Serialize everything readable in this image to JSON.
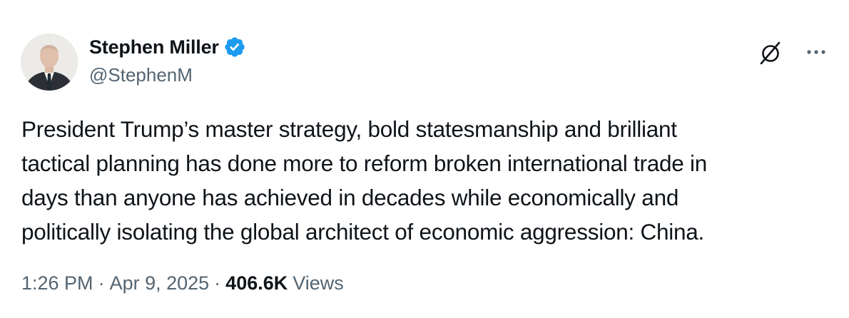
{
  "author": {
    "display_name": "Stephen Miller",
    "handle": "@StephenM",
    "verified": true
  },
  "tweet": {
    "text_lines": [
      "President Trump’s master strategy, bold statesmanship and brilliant",
      "tactical planning has done more to reform broken international trade in",
      "days than anyone has achieved in decades while economically and",
      "politically isolating the global architect of economic aggression: China."
    ]
  },
  "meta": {
    "time": "1:26 PM",
    "separator": "·",
    "date": "Apr 9, 2025",
    "views_count": "406.6K",
    "views_label": "Views"
  },
  "icons": {
    "verified": "verified-badge-icon",
    "grok": "grok-icon",
    "more": "more-options-icon"
  },
  "colors": {
    "text_primary": "#0f1419",
    "text_secondary": "#536471",
    "verified_blue": "#1d9bf0",
    "background": "#ffffff"
  }
}
